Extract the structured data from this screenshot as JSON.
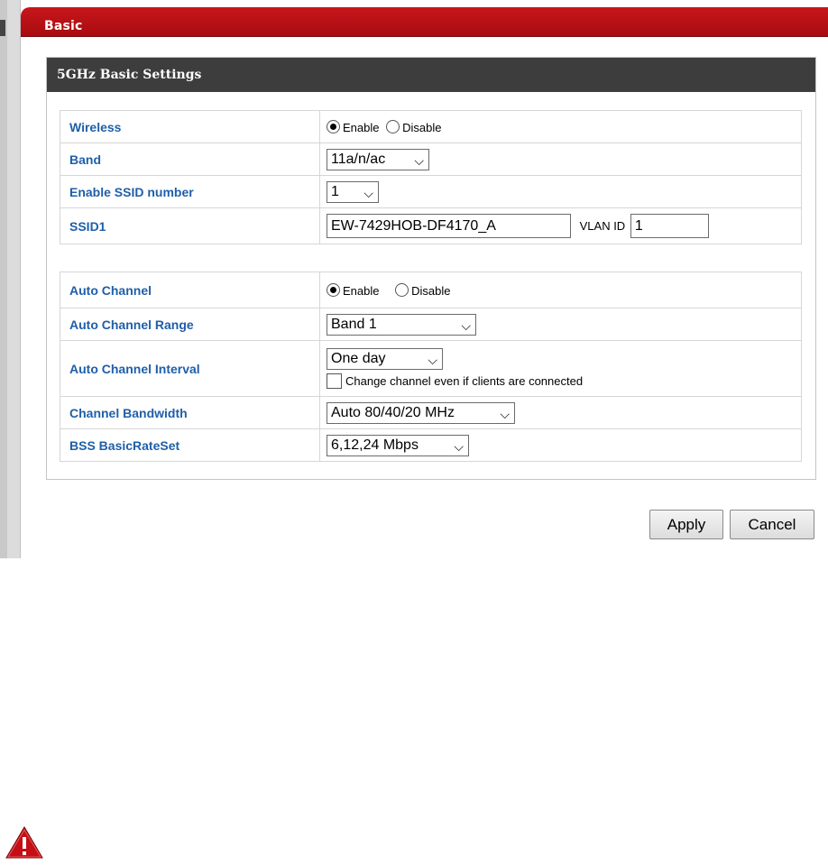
{
  "page": {
    "title": "Basic"
  },
  "section": {
    "title": "5GHz Basic Settings"
  },
  "rows": {
    "wireless": {
      "label": "Wireless",
      "enable": "Enable",
      "disable": "Disable",
      "selected": "Enable"
    },
    "band": {
      "label": "Band",
      "value": "11a/n/ac"
    },
    "ssid_number": {
      "label": "Enable SSID number",
      "value": "1"
    },
    "ssid1": {
      "label": "SSID1",
      "value": "EW-7429HOB-DF4170_A",
      "vlan_label": "VLAN ID",
      "vlan_value": "1"
    },
    "auto_channel": {
      "label": "Auto Channel",
      "enable": "Enable",
      "disable": "Disable",
      "selected": "Enable"
    },
    "auto_channel_range": {
      "label": "Auto Channel Range",
      "value": "Band 1"
    },
    "auto_channel_interval": {
      "label": "Auto Channel Interval",
      "value": "One day",
      "checkbox_label": "Change channel even if clients are connected",
      "checked": false
    },
    "channel_bandwidth": {
      "label": "Channel Bandwidth",
      "value": "Auto 80/40/20 MHz"
    },
    "bss_basic_rate_set": {
      "label": "BSS BasicRateSet",
      "value": "6,12,24 Mbps"
    }
  },
  "buttons": {
    "apply": "Apply",
    "cancel": "Cancel"
  },
  "icons": {
    "chevron": "chevron-down-icon",
    "warning": "warning-icon"
  },
  "colors": {
    "title_bar": "#b51015",
    "section_header": "#3d3d3d",
    "label_blue": "#1f5fa8"
  }
}
